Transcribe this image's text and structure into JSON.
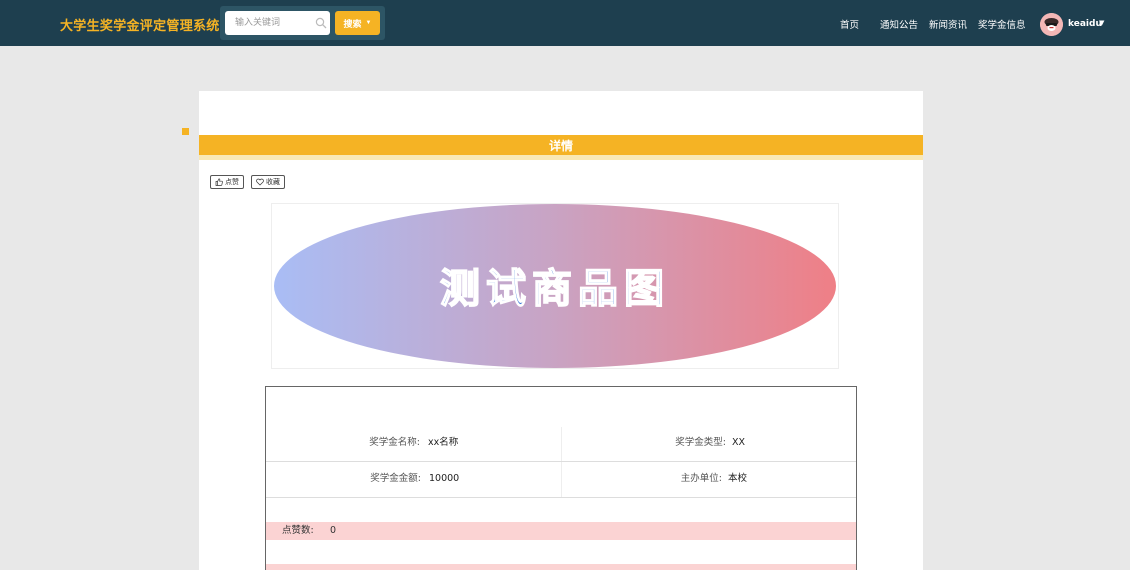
{
  "header": {
    "site_title": "大学生奖学金评定管理系统",
    "search": {
      "placeholder": "输入关键词",
      "button_label": "搜索"
    },
    "nav": [
      "首页",
      "通知公告",
      "新闻资讯",
      "奖学金信息"
    ],
    "user": {
      "name": "keaidu"
    }
  },
  "detail": {
    "heading": "详情",
    "like_label": "点赞",
    "favorite_label": "收藏",
    "image_text": "测试商品图"
  },
  "info": {
    "fields": [
      {
        "label": "奖学金名称:",
        "value": "xx名称"
      },
      {
        "label": "奖学金类型:",
        "value": "XX"
      },
      {
        "label": "奖学金金额:",
        "value": "10000"
      },
      {
        "label": "主办单位:",
        "value": "本校"
      }
    ],
    "likes": {
      "label": "点赞数:",
      "value": "0"
    }
  },
  "colors": {
    "header_bg": "#1e3f4f",
    "accent": "#f5b324",
    "stat_row": "#fbd3d3"
  }
}
